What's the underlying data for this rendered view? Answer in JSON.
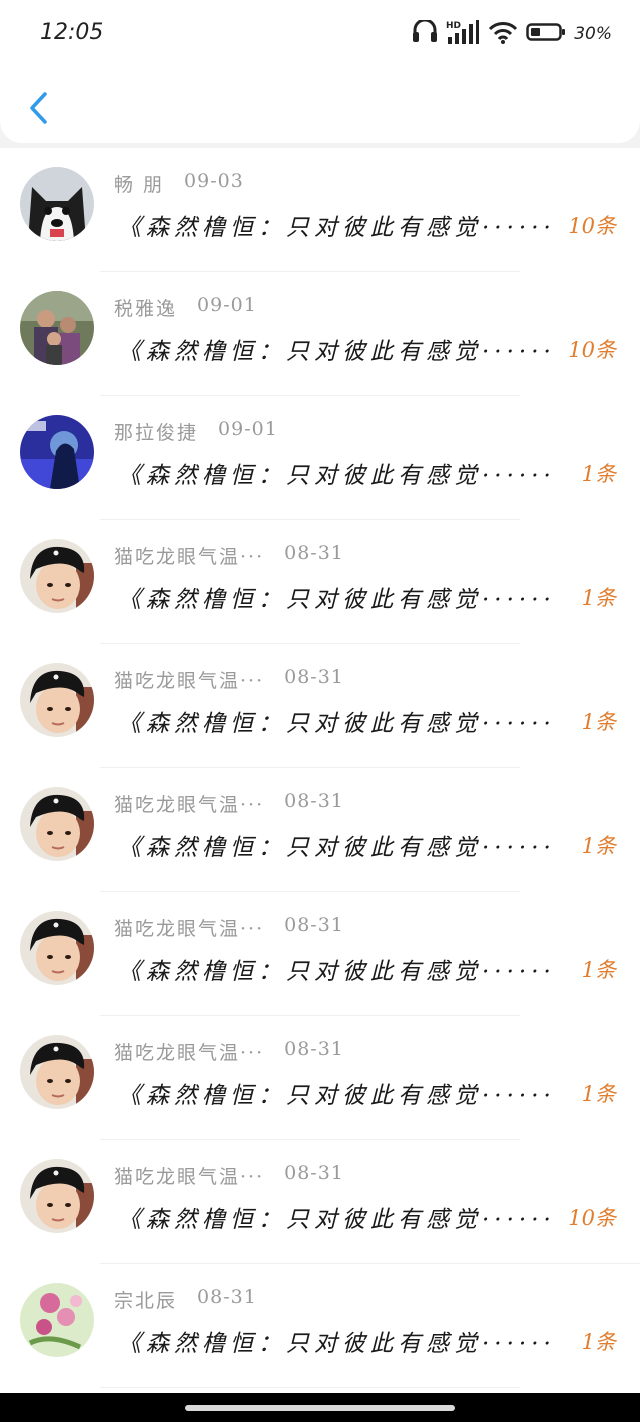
{
  "status": {
    "time": "12:05",
    "battery": "30%"
  },
  "list": {
    "items": [
      {
        "name": "畅 朋",
        "date": "09-03",
        "title": "《森然橹恒：只对彼此有感觉······",
        "count": "10条",
        "avatar": "husky"
      },
      {
        "name": "税雅逸",
        "date": "09-01",
        "title": "《森然橹恒：只对彼此有感觉······",
        "count": "10条",
        "avatar": "family"
      },
      {
        "name": "那拉俊捷",
        "date": "09-01",
        "title": "《森然橹恒：只对彼此有感觉······",
        "count": "1条",
        "avatar": "concert"
      },
      {
        "name": "猫吃龙眼气温···",
        "date": "08-31",
        "title": "《森然橹恒：只对彼此有感觉······",
        "count": "1条",
        "avatar": "boy"
      },
      {
        "name": "猫吃龙眼气温···",
        "date": "08-31",
        "title": "《森然橹恒：只对彼此有感觉······",
        "count": "1条",
        "avatar": "boy"
      },
      {
        "name": "猫吃龙眼气温···",
        "date": "08-31",
        "title": "《森然橹恒：只对彼此有感觉······",
        "count": "1条",
        "avatar": "boy"
      },
      {
        "name": "猫吃龙眼气温···",
        "date": "08-31",
        "title": "《森然橹恒：只对彼此有感觉······",
        "count": "1条",
        "avatar": "boy"
      },
      {
        "name": "猫吃龙眼气温···",
        "date": "08-31",
        "title": "《森然橹恒：只对彼此有感觉······",
        "count": "1条",
        "avatar": "boy"
      },
      {
        "name": "猫吃龙眼气温···",
        "date": "08-31",
        "title": "《森然橹恒：只对彼此有感觉······",
        "count": "10条",
        "avatar": "boy"
      },
      {
        "name": "宗北辰",
        "date": "08-31",
        "title": "《森然橹恒：只对彼此有感觉······",
        "count": "1条",
        "avatar": "flowers"
      }
    ]
  },
  "colors": {
    "accent": "#2f9bea",
    "count": "#e07d2e",
    "name": "#9a9a9a"
  }
}
